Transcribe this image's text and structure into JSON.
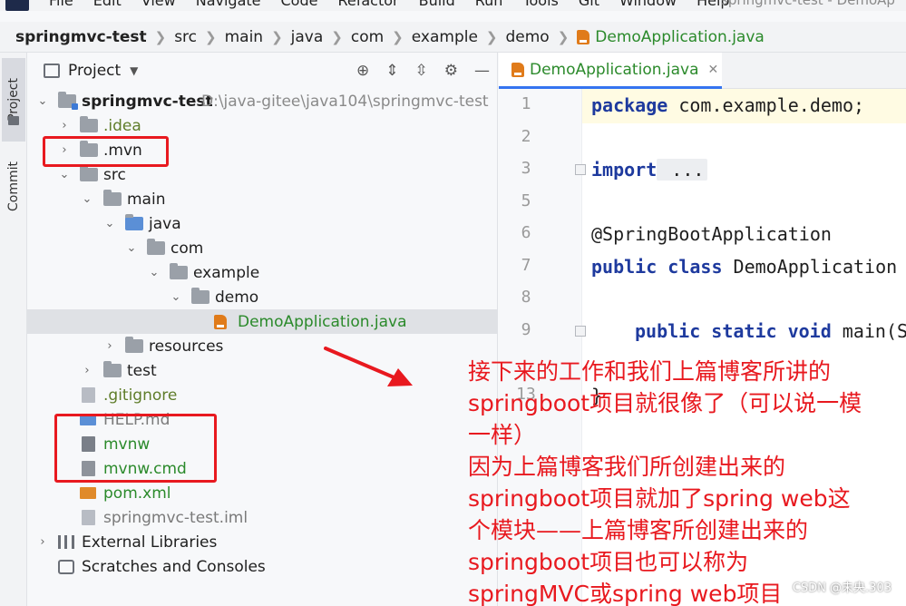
{
  "menubar": {
    "items": [
      "File",
      "Edit",
      "View",
      "Navigate",
      "Code",
      "Refactor",
      "Build",
      "Run",
      "Tools",
      "Git",
      "Window",
      "Help"
    ],
    "window_title": "springmvc-test - DemoAp"
  },
  "breadcrumb": {
    "items": [
      "springmvc-test",
      "src",
      "main",
      "java",
      "com",
      "example",
      "demo"
    ],
    "file": "DemoApplication.java"
  },
  "toolstrip": {
    "project_tab": "Project",
    "commit_tab": "Commit"
  },
  "project_panel": {
    "title": "Project",
    "tree": {
      "root_name": "springmvc-test",
      "root_path": "D:\\java-gitee\\java104\\springmvc-test",
      "idea": ".idea",
      "mvn": ".mvn",
      "src": "src",
      "main": "main",
      "java": "java",
      "com": "com",
      "example": "example",
      "demo": "demo",
      "demo_app": "DemoApplication.java",
      "resources": "resources",
      "test": "test",
      "gitignore": ".gitignore",
      "help_md": "HELP.md",
      "mvnw": "mvnw",
      "mvnw_cmd": "mvnw.cmd",
      "pom": "pom.xml",
      "iml": "springmvc-test.iml",
      "external_libraries": "External Libraries",
      "scratches": "Scratches and Consoles"
    }
  },
  "editor": {
    "tab": "DemoApplication.java",
    "lines": [
      {
        "num": "1",
        "kw": "package",
        "rest": " com.example.demo;"
      },
      {
        "num": "2",
        "kw": "",
        "rest": ""
      },
      {
        "num": "3",
        "kw": "import",
        "rest": " ..."
      },
      {
        "num": "5",
        "kw": "",
        "rest": ""
      },
      {
        "num": "6",
        "kw": "",
        "rest": "@SpringBootApplication"
      },
      {
        "num": "7",
        "kw": "public class",
        "rest": " DemoApplication"
      },
      {
        "num": "8",
        "kw": "",
        "rest": ""
      },
      {
        "num": "9",
        "kw": "public static void",
        "rest": " main(S"
      },
      {
        "num": "13",
        "kw": "",
        "rest": "}"
      }
    ]
  },
  "annotation": {
    "lines": [
      "接下来的工作和我们上篇博客所讲的",
      "springboot项目就很像了（可以说一模",
      "一样）",
      "因为上篇博客我们所创建出来的",
      "springboot项目就加了spring web这",
      "个模块——上篇博客所创建出来的",
      "springboot项目也可以称为",
      "springMVC或spring web项目"
    ],
    "color": "#e8191f"
  },
  "watermark": "CSDN @未央.303"
}
